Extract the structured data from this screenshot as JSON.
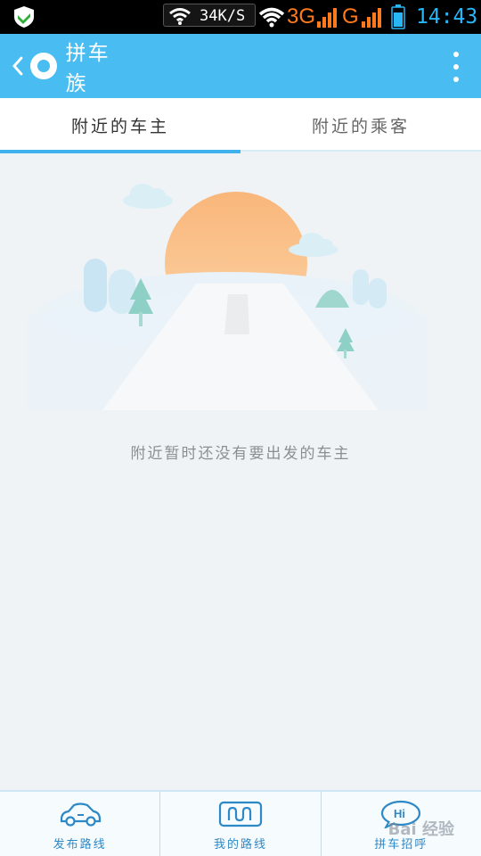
{
  "status_bar": {
    "speed": "34K/S",
    "network_1": "3G",
    "network_2": "G",
    "time": "14:43",
    "colors": {
      "network": "#ff7a1a",
      "time": "#29b6f6"
    }
  },
  "app_bar": {
    "title": "拼车族",
    "color": "#49bdf1",
    "icons": {
      "back": "chevron-left-icon",
      "logo": "app-logo-icon",
      "menu": "more-vertical-icon"
    }
  },
  "tabs": [
    {
      "label": "附近的车主",
      "active": true
    },
    {
      "label": "附近的乘客",
      "active": false
    }
  ],
  "empty_state": {
    "message": "附近暂时还没有要出发的车主",
    "illustration": "sunrise-road-illustration"
  },
  "bottom_nav": [
    {
      "label": "发布路线",
      "icon": "car-icon"
    },
    {
      "label": "我的路线",
      "icon": "route-icon"
    },
    {
      "label": "拼车招呼",
      "icon": "chat-bubble-icon"
    }
  ],
  "watermark": "Bai 经验"
}
